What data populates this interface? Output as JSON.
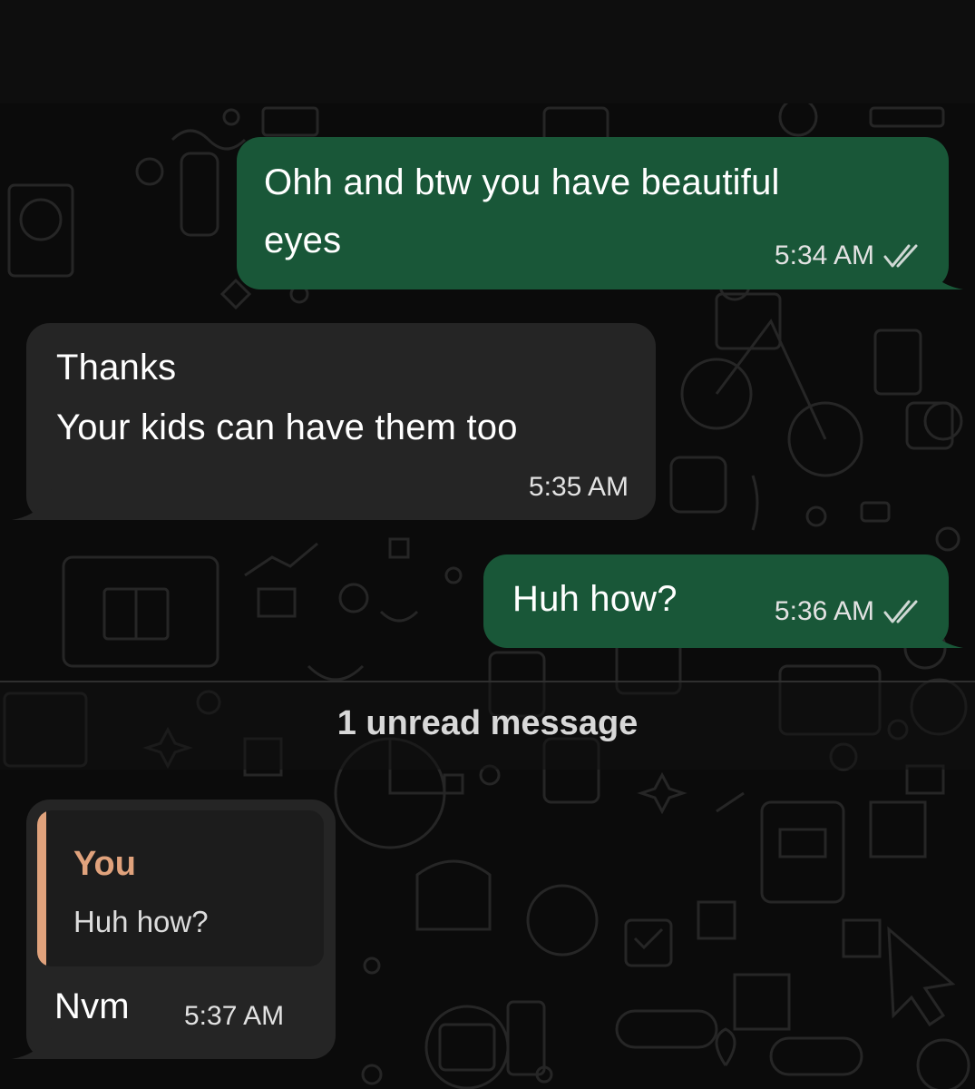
{
  "theme": {
    "outgoing_bubble": "#195738",
    "incoming_bubble": "#252525",
    "reply_accent": "#e0a27c",
    "read_tick_color": "#cfd8d4"
  },
  "messages": [
    {
      "direction": "outgoing",
      "text": "Ohh and btw you have beautiful\neyes",
      "time": "5:34 AM",
      "status_icon": "double-check-icon"
    },
    {
      "direction": "incoming",
      "text": "Thanks\nYour kids can have them too",
      "time": "5:35 AM"
    },
    {
      "direction": "outgoing",
      "text": "Huh how?",
      "time": "5:36 AM",
      "status_icon": "double-check-icon"
    },
    {
      "direction": "incoming",
      "quoted": {
        "author": "You",
        "text": "Huh how?"
      },
      "text": "Nvm",
      "time": "5:37 AM"
    }
  ],
  "unread_divider": {
    "label": "1 unread message"
  }
}
